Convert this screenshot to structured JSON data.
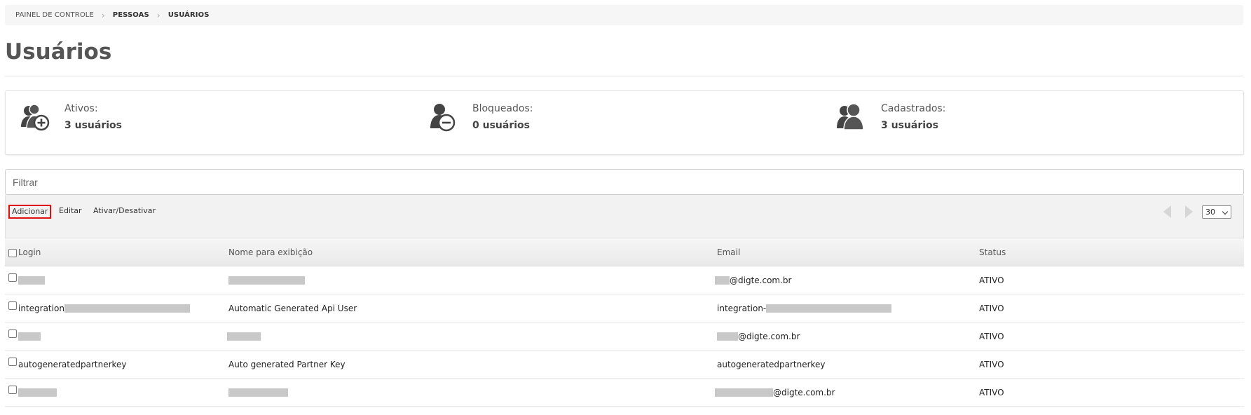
{
  "breadcrumb": [
    "PAINEL DE CONTROLE",
    "PESSOAS",
    "USUÁRIOS"
  ],
  "title": "Usuários",
  "stats": {
    "active": {
      "label": "Ativos:",
      "value": "3 usuários"
    },
    "blocked": {
      "label": "Bloqueados:",
      "value": "0 usuários"
    },
    "registered": {
      "label": "Cadastrados:",
      "value": "3 usuários"
    }
  },
  "filter": {
    "placeholder": "Filtrar"
  },
  "toolbar": {
    "add": "Adicionar",
    "edit": "Editar",
    "toggle": "Ativar/Desativar",
    "page_size": "30"
  },
  "table": {
    "headers": {
      "login": "Login",
      "name": "Nome para exibição",
      "email": "Email",
      "status": "Status"
    },
    "rows": [
      {
        "login": "",
        "name": "",
        "email": "@digte.com.br",
        "status": "ATIVO"
      },
      {
        "login": "integration",
        "name": "Automatic Generated Api User",
        "email": "integration-",
        "status": "ATIVO"
      },
      {
        "login": "",
        "name": "",
        "email": "@digte.com.br",
        "status": "ATIVO"
      },
      {
        "login": "autogeneratedpartnerkey",
        "name": "Auto generated Partner Key",
        "email": "autogeneratedpartnerkey",
        "status": "ATIVO"
      },
      {
        "login": "",
        "name": "",
        "email": "@digte.com.br",
        "status": "ATIVO"
      }
    ]
  },
  "colors": {
    "accent_red": "#e01010",
    "header_bg": "#eeeeee",
    "redaction": "#c8c8c8"
  }
}
